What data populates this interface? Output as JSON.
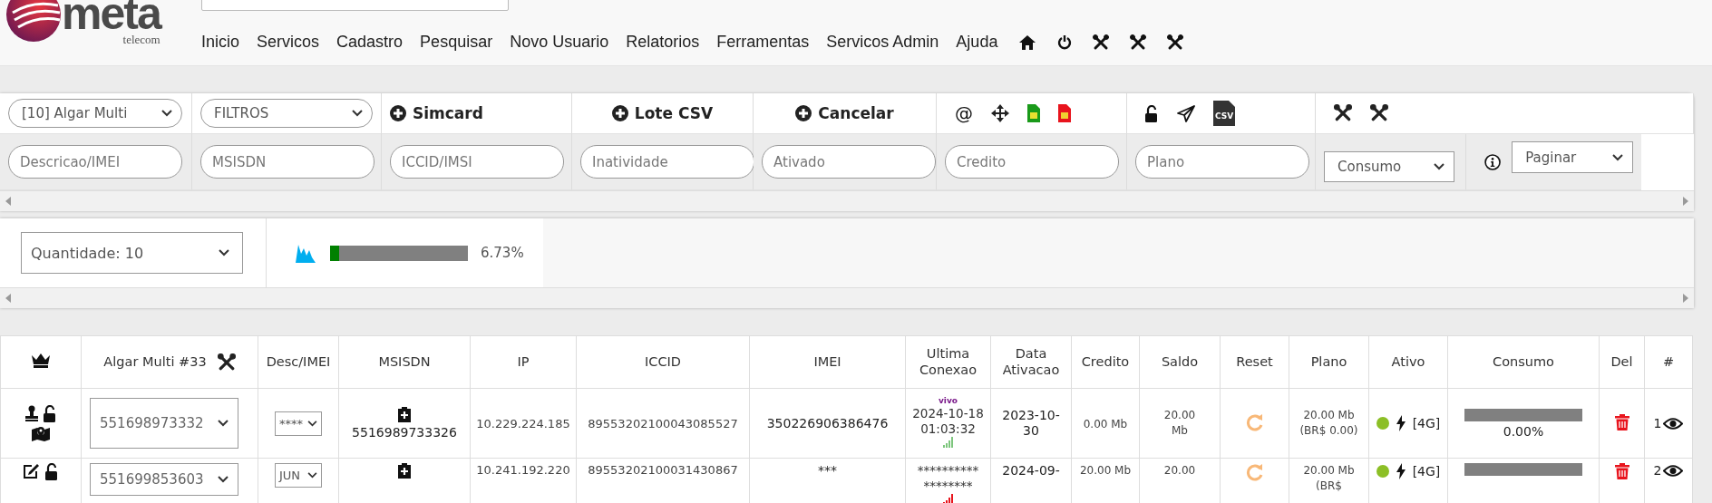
{
  "logo": {
    "name": "meta",
    "tagline": "telecom"
  },
  "nav": [
    "Inicio",
    "Servicos",
    "Cadastro",
    "Pesquisar",
    "Novo Usuario",
    "Relatorios",
    "Ferramentas",
    "Servicos Admin",
    "Ajuda"
  ],
  "filters": {
    "company": "[10] Algar Multi",
    "filter": "FILTROS",
    "actions": [
      "Simcard",
      "Lote CSV",
      "Cancelar"
    ],
    "at_char": "@",
    "csv_label": "CSV",
    "fields": [
      {
        "placeholder": "Descricao/IMEI"
      },
      {
        "placeholder": "MSISDN"
      },
      {
        "placeholder": "ICCID/IMSI"
      },
      {
        "placeholder": "Inatividade"
      },
      {
        "placeholder": "Ativado"
      },
      {
        "placeholder": "Credito"
      },
      {
        "placeholder": "Plano"
      }
    ],
    "consumo": "Consumo",
    "paginar": "Paginar"
  },
  "summary": {
    "quantity": "Quantidade: 10",
    "level": 0.0673,
    "percent": "6.73%"
  },
  "table": {
    "columns": [
      {
        "kind": "crown"
      },
      {
        "kind": "tools",
        "label": "Algar Multi #33"
      },
      {
        "label": "Desc/IMEI"
      },
      {
        "label": "MSISDN"
      },
      {
        "label": "IP"
      },
      {
        "label": "ICCID"
      },
      {
        "label": "IMEI"
      },
      {
        "label": "Ultima Conexao"
      },
      {
        "label": "Data Ativacao"
      },
      {
        "label": "Credito"
      },
      {
        "label": "Saldo"
      },
      {
        "label": "Reset"
      },
      {
        "label": "Plano"
      },
      {
        "label": "Ativo"
      },
      {
        "label": "Consumo"
      },
      {
        "label": "Del"
      },
      {
        "label": "#"
      }
    ],
    "rows": [
      {
        "kind": "stamp",
        "line": "551698973332",
        "desc": "****",
        "msisdn": "5516989733326",
        "ip": "10.229.224.185",
        "iccid": "89553202100043085527",
        "imei": "350226906386476",
        "operator": "vivo",
        "last_seen": "2024-10-18 01:03:32",
        "signal": {
          "color": "#7dc67d"
        },
        "activated": "2023-10-30",
        "credit": "0.00 Mb",
        "balance": "20.00 Mb",
        "plan": "20.00 Mb (BR$ 0.00)",
        "status": {
          "color": "#8cbf26"
        },
        "network": "[4G]",
        "level": 0,
        "usage": "0.00%",
        "index": "1"
      },
      {
        "kind": "edit",
        "line": "551699853603",
        "desc": "JUN",
        "ip": "10.241.192.220",
        "iccid": "89553202100031430867",
        "imei": "***",
        "last_seen": "********** ********",
        "signal": {
          "color": "#e8141d"
        },
        "activated": "2024-09-",
        "credit": "20.00 Mb",
        "balance": "20.00",
        "plan": "20.00 Mb (BR$",
        "status": {
          "color": "#8cbf26"
        },
        "network": "[4G]",
        "level": 0,
        "index": "2"
      }
    ]
  }
}
